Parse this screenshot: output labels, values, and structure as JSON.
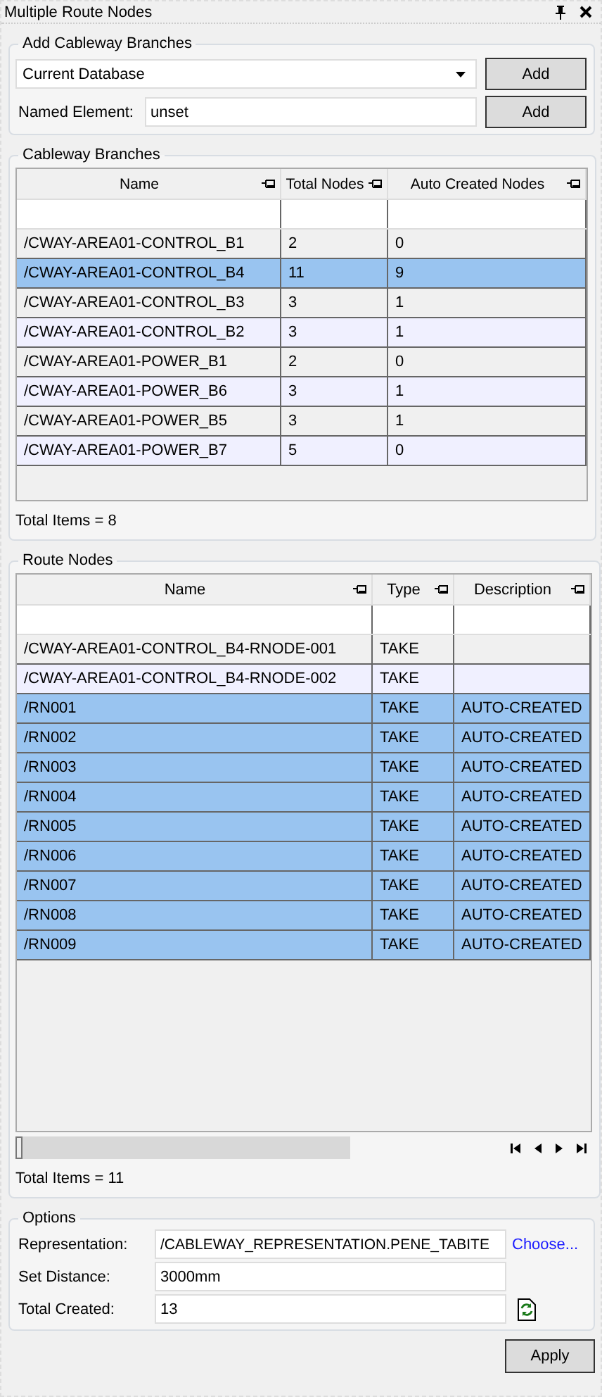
{
  "window": {
    "title": "Multiple Route Nodes"
  },
  "add_branches": {
    "title": "Add Cableway Branches",
    "source": "Current Database",
    "add_button": "Add",
    "named_element_label": "Named Element:",
    "named_element_value": "unset",
    "named_add_button": "Add"
  },
  "branches": {
    "title": "Cableway Branches",
    "columns": [
      "Name",
      "Total Nodes",
      "Auto Created Nodes"
    ],
    "rows": [
      {
        "cells": [
          "/CWAY-AREA01-CONTROL_B1",
          "2",
          "0"
        ],
        "selected": false
      },
      {
        "cells": [
          "/CWAY-AREA01-CONTROL_B4",
          "11",
          "9"
        ],
        "selected": true
      },
      {
        "cells": [
          "/CWAY-AREA01-CONTROL_B3",
          "3",
          "1"
        ],
        "selected": false
      },
      {
        "cells": [
          "/CWAY-AREA01-CONTROL_B2",
          "3",
          "1"
        ],
        "selected": false
      },
      {
        "cells": [
          "/CWAY-AREA01-POWER_B1",
          "2",
          "0"
        ],
        "selected": false
      },
      {
        "cells": [
          "/CWAY-AREA01-POWER_B6",
          "3",
          "1"
        ],
        "selected": false
      },
      {
        "cells": [
          "/CWAY-AREA01-POWER_B5",
          "3",
          "1"
        ],
        "selected": false
      },
      {
        "cells": [
          "/CWAY-AREA01-POWER_B7",
          "5",
          "0"
        ],
        "selected": false
      }
    ],
    "footer": "Total Items = 8"
  },
  "route_nodes": {
    "title": "Route Nodes",
    "columns": [
      "Name",
      "Type",
      "Description"
    ],
    "rows": [
      {
        "cells": [
          "/CWAY-AREA01-CONTROL_B4-RNODE-001",
          "TAKE"
        ],
        "selected": false
      },
      {
        "cells": [
          "/CWAY-AREA01-CONTROL_B4-RNODE-002",
          "TAKE"
        ],
        "selected": false
      },
      {
        "cells": [
          "/RN001",
          "TAKE",
          "AUTO-CREATED"
        ],
        "selected": true
      },
      {
        "cells": [
          "/RN002",
          "TAKE",
          "AUTO-CREATED"
        ],
        "selected": true
      },
      {
        "cells": [
          "/RN003",
          "TAKE",
          "AUTO-CREATED"
        ],
        "selected": true
      },
      {
        "cells": [
          "/RN004",
          "TAKE",
          "AUTO-CREATED"
        ],
        "selected": true
      },
      {
        "cells": [
          "/RN005",
          "TAKE",
          "AUTO-CREATED"
        ],
        "selected": true
      },
      {
        "cells": [
          "/RN006",
          "TAKE",
          "AUTO-CREATED"
        ],
        "selected": true
      },
      {
        "cells": [
          "/RN007",
          "TAKE",
          "AUTO-CREATED"
        ],
        "selected": true
      },
      {
        "cells": [
          "/RN008",
          "TAKE",
          "AUTO-CREATED"
        ],
        "selected": true
      },
      {
        "cells": [
          "/RN009",
          "TAKE",
          "AUTO-CREATED"
        ],
        "selected": true
      }
    ],
    "footer": "Total Items = 11"
  },
  "options": {
    "title": "Options",
    "representation_label": "Representation:",
    "representation_value": "/CABLEWAY_REPRESENTATION.PENE_TABITE",
    "choose_link": "Choose...",
    "distance_label": "Set Distance:",
    "distance_value": "3000mm",
    "total_label": "Total Created:",
    "total_value": "13"
  },
  "apply_button": "Apply"
}
